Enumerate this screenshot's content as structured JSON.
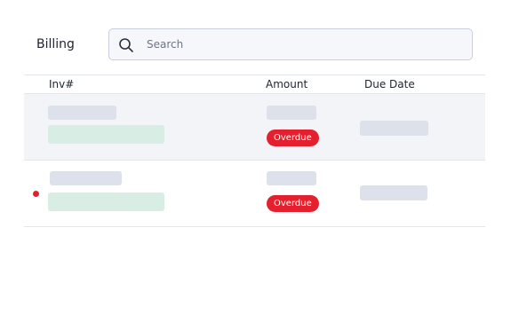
{
  "header": {
    "title": "Billing"
  },
  "search": {
    "placeholder": "Search",
    "value": ""
  },
  "table": {
    "columns": {
      "invoice": "Inv#",
      "amount": "Amount",
      "due_date": "Due Date"
    },
    "rows": [
      {
        "status": "Overdue",
        "unread": false
      },
      {
        "status": "Overdue",
        "unread": true
      }
    ]
  },
  "colors": {
    "status_overdue": "#e5202e",
    "skeleton": "#dde1eb",
    "skeleton_green": "#d8ede3",
    "row_highlight": "#f3f4f8"
  }
}
